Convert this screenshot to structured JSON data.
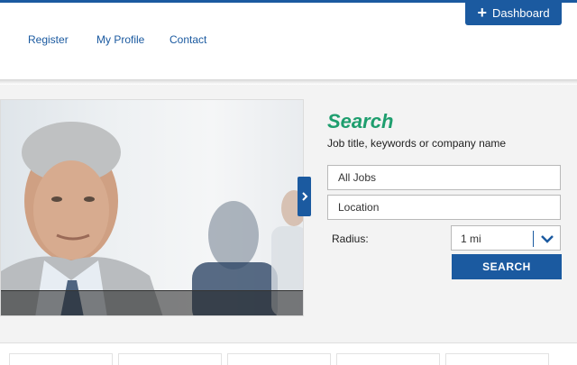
{
  "header": {
    "dashboard_label": "Dashboard",
    "nav": [
      {
        "label": "Register"
      },
      {
        "label": "My Profile"
      },
      {
        "label": "Contact"
      }
    ]
  },
  "search": {
    "title": "Search",
    "subtitle": "Job title, keywords or company name",
    "keywords_value": "All Jobs",
    "location_value": "Location",
    "radius_label": "Radius:",
    "radius_value": "1 mi",
    "button_label": "SEARCH"
  },
  "colors": {
    "brand_blue": "#1b5aa0",
    "search_green": "#1e9e6e"
  },
  "icons": [
    "plus-icon",
    "chevron-right-icon",
    "chevron-down-icon"
  ]
}
